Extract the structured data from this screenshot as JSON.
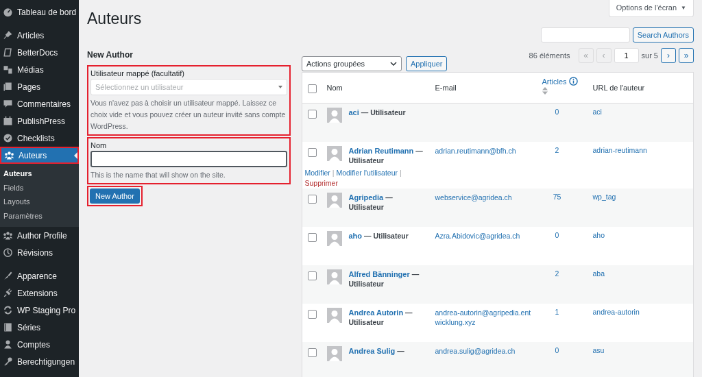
{
  "sidebar": {
    "groups": [
      [
        {
          "label": "Tableau de bord",
          "selected": false,
          "highlighted": false
        }
      ],
      [
        {
          "label": "Articles",
          "selected": false,
          "highlighted": false
        },
        {
          "label": "BetterDocs",
          "selected": false,
          "highlighted": false
        },
        {
          "label": "Médias",
          "selected": false,
          "highlighted": false
        },
        {
          "label": "Pages",
          "selected": false,
          "highlighted": false
        },
        {
          "label": "Commentaires",
          "selected": false,
          "highlighted": false
        },
        {
          "label": "PublishPress",
          "selected": false,
          "highlighted": false
        },
        {
          "label": "Checklists",
          "selected": false,
          "highlighted": false
        },
        {
          "label": "Auteurs",
          "selected": true,
          "highlighted": true,
          "children": [
            {
              "label": "Auteurs",
              "selected": true
            },
            {
              "label": "Fields",
              "selected": false
            },
            {
              "label": "Layouts",
              "selected": false
            },
            {
              "label": "Paramètres",
              "selected": false
            }
          ]
        },
        {
          "label": "Author Profile",
          "selected": false,
          "highlighted": false
        },
        {
          "label": "Révisions",
          "selected": false,
          "highlighted": false
        }
      ],
      [
        {
          "label": "Apparence",
          "selected": false,
          "highlighted": false
        },
        {
          "label": "Extensions",
          "selected": false,
          "highlighted": false
        },
        {
          "label": "WP Staging Pro",
          "selected": false,
          "highlighted": false
        },
        {
          "label": "Séries",
          "selected": false,
          "highlighted": false
        },
        {
          "label": "Comptes",
          "selected": false,
          "highlighted": false
        },
        {
          "label": "Berechtigungen",
          "selected": false,
          "highlighted": false
        }
      ]
    ]
  },
  "page_title": "Auteurs",
  "screen_options": {
    "label": "Options de l'écran",
    "caret": "▼"
  },
  "form": {
    "title": "New Author",
    "mapped_user": {
      "label": "Utilisateur mappé (facultatif)",
      "placeholder": "Sélectionnez un utilisateur",
      "help": "Vous n'avez pas à choisir un utilisateur mappé. Laissez ce choix vide et vous pouvez créer un auteur invité sans compte WordPress.",
      "highlighted": true
    },
    "name": {
      "label": "Nom",
      "help": "This is the name that will show on the site.",
      "highlighted": true
    },
    "submit": {
      "label": "New Author",
      "highlighted": true
    }
  },
  "search": {
    "button": "Search Authors"
  },
  "bulk": {
    "value": "Actions groupées",
    "apply": "Appliquer"
  },
  "pagination": {
    "count": "86 éléments",
    "first": {
      "label": "«",
      "disabled": true
    },
    "prev": {
      "label": "‹",
      "disabled": true
    },
    "page": "1",
    "of": "sur 5",
    "next": {
      "label": "›",
      "disabled": false
    },
    "last": {
      "label": "»",
      "disabled": false
    }
  },
  "table": {
    "select_all_checked": false,
    "columns": [
      {
        "label": "Nom",
        "sortable": false
      },
      {
        "label": "E-mail",
        "sortable": false
      },
      {
        "label": "Articles",
        "sortable": true
      },
      {
        "label": "URL de l'auteur",
        "sortable": false
      }
    ],
    "rows": [
      {
        "name": "aci",
        "role": "— Utilisateur",
        "email": "",
        "articles": "0",
        "url": "aci",
        "checked": false
      },
      {
        "name": "Adrian Reutimann",
        "role": "— Utilisateur",
        "email": "adrian.reutimann@bfh.ch",
        "articles": "2",
        "url": "adrian-reutimann",
        "checked": false,
        "action_separator": "|",
        "actions": [
          {
            "label": "Modifier",
            "kind": "link"
          },
          {
            "label": "Modifier l'utilisateur",
            "kind": "link"
          },
          {
            "label": "Supprimer",
            "kind": "delete"
          }
        ]
      },
      {
        "name": "Agripedia",
        "role": "— Utilisateur",
        "email": "webservice@agridea.ch",
        "articles": "75",
        "url": "wp_tag",
        "checked": false
      },
      {
        "name": "aho",
        "role": "— Utilisateur",
        "email": "Azra.Abidovic@agridea.ch",
        "articles": "0",
        "url": "aho",
        "checked": false
      },
      {
        "name": "Alfred Bänninger",
        "role": "— Utilisateur",
        "email": "",
        "articles": "2",
        "url": "aba",
        "checked": false
      },
      {
        "name": "Andrea Autorin",
        "role": "— Utilisateur",
        "email": "andrea-autorin@agripedia.entwicklung.xyz",
        "articles": "1",
        "url": "andrea-autorin",
        "checked": false
      },
      {
        "name": "Andrea Sulig",
        "role": "—",
        "email": "andrea.sulig@agridea.ch",
        "articles": "0",
        "url": "asu",
        "checked": false
      }
    ]
  }
}
